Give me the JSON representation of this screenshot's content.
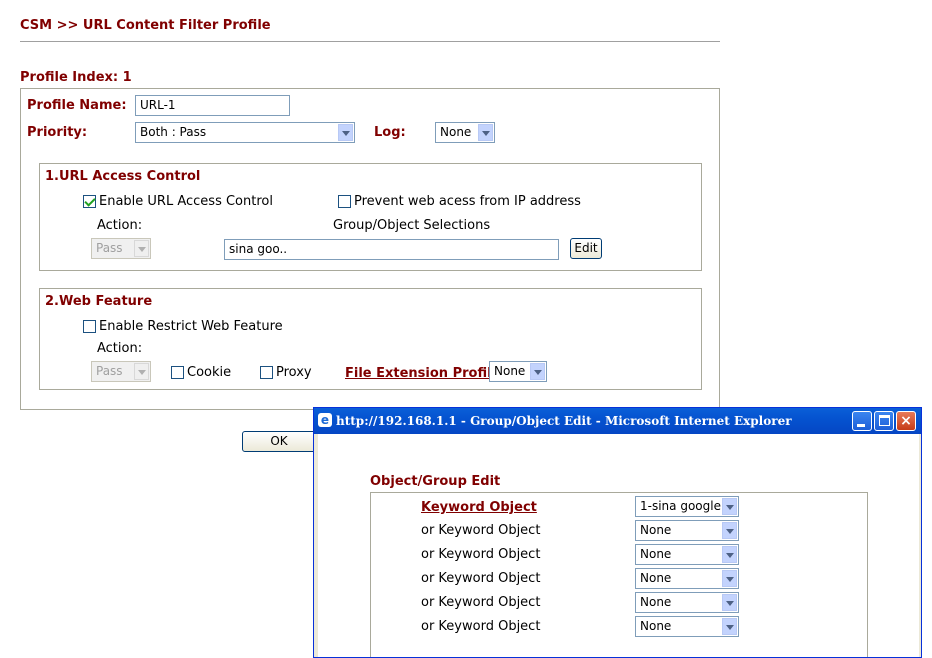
{
  "page": {
    "title": "CSM >> URL Content Filter Profile",
    "profile_index_label": "Profile Index: 1"
  },
  "profile": {
    "name_label": "Profile Name:",
    "name_value": "URL-1",
    "priority_label": "Priority:",
    "priority_value": "Both : Pass",
    "log_label": "Log:",
    "log_value": "None"
  },
  "url_access": {
    "heading": "1.URL Access Control",
    "enable_label": "Enable URL Access Control",
    "enable_checked": true,
    "prevent_label": "Prevent web acess from IP address",
    "prevent_checked": false,
    "action_label": "Action:",
    "action_value": "Pass",
    "group_label": "Group/Object Selections",
    "group_value": "sina goo..",
    "edit_label": "Edit"
  },
  "web_feature": {
    "heading": "2.Web Feature",
    "enable_label": "Enable Restrict Web Feature",
    "enable_checked": false,
    "action_label": "Action:",
    "action_value": "Pass",
    "cookie_label": "Cookie",
    "proxy_label": "Proxy",
    "file_ext_label": "File Extension Profile:",
    "file_ext_value": "None"
  },
  "ok_label": "OK",
  "popup": {
    "title": "http://192.168.1.1 - Group/Object Edit - Microsoft Internet Explorer",
    "heading": "Object/Group Edit",
    "rows": [
      {
        "label": "Keyword Object",
        "value": "1-sina google"
      },
      {
        "label": "or Keyword Object",
        "value": "None"
      },
      {
        "label": "or Keyword Object",
        "value": "None"
      },
      {
        "label": "or Keyword Object",
        "value": "None"
      },
      {
        "label": "or Keyword Object",
        "value": "None"
      },
      {
        "label": "or Keyword Object",
        "value": "None"
      }
    ]
  },
  "icons": [
    "ie-icon",
    "minimize-icon",
    "maximize-icon",
    "close-icon",
    "chevron-down-icon"
  ],
  "colors": {
    "heading": "#800000",
    "titlebar": "#0553d0"
  }
}
